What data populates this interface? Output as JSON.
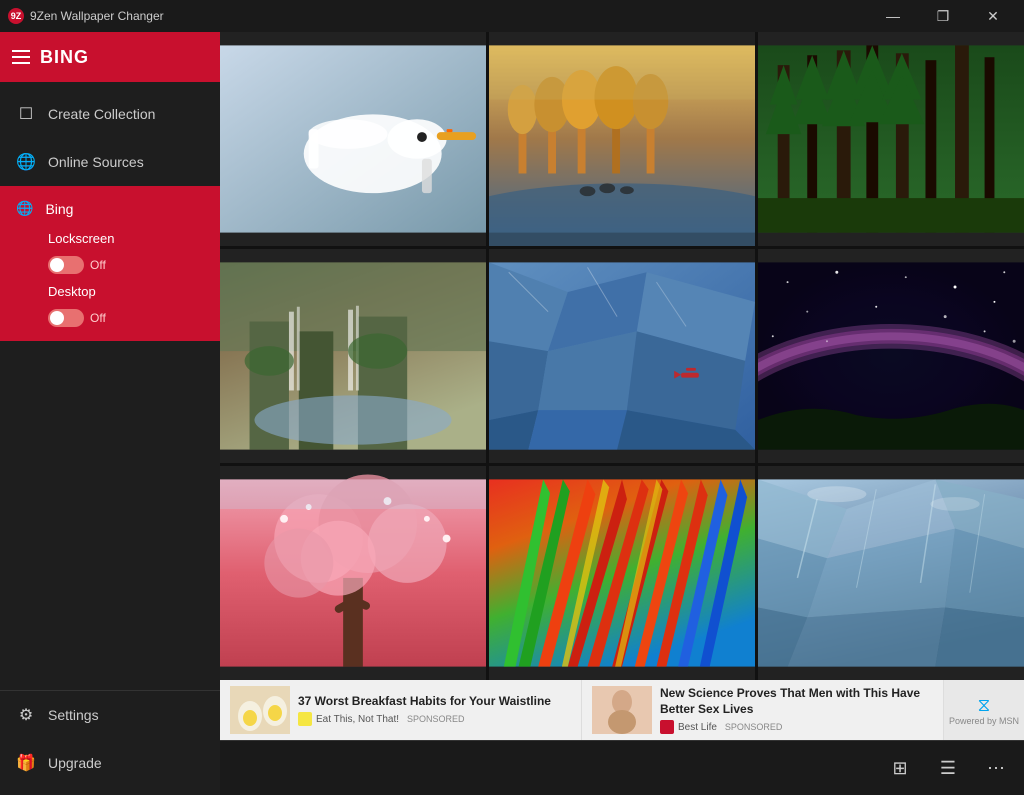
{
  "titlebar": {
    "title": "9Zen Wallpaper Changer",
    "controls": {
      "minimize": "—",
      "maximize": "❐",
      "close": "✕"
    }
  },
  "sidebar": {
    "title": "BING",
    "items": [
      {
        "id": "create-collection",
        "label": "Create Collection",
        "icon": "☐"
      },
      {
        "id": "online-sources",
        "label": "Online Sources",
        "icon": "🌐"
      }
    ],
    "bing": {
      "label": "Bing",
      "icon": "🌐",
      "lockscreen": {
        "label": "Lockscreen",
        "state": "Off"
      },
      "desktop": {
        "label": "Desktop",
        "state": "Off"
      }
    },
    "bottom_items": [
      {
        "id": "settings",
        "label": "Settings",
        "icon": "⚙"
      },
      {
        "id": "upgrade",
        "label": "Upgrade",
        "icon": "🎁"
      }
    ]
  },
  "ads": [
    {
      "headline": "37 Worst Breakfast Habits for Your Waistline",
      "source": "Eat This, Not That!",
      "sponsored": "SPONSORED",
      "badge_color": "#f5e642"
    },
    {
      "headline": "New Science Proves That Men with This Have Better Sex Lives",
      "source": "Best Life",
      "sponsored": "SPONSORED",
      "badge_color": "#c8102e"
    }
  ],
  "bottom_bar": {
    "btn1_icon": "⊞",
    "btn2_icon": "☰",
    "btn3_icon": "⋯"
  }
}
